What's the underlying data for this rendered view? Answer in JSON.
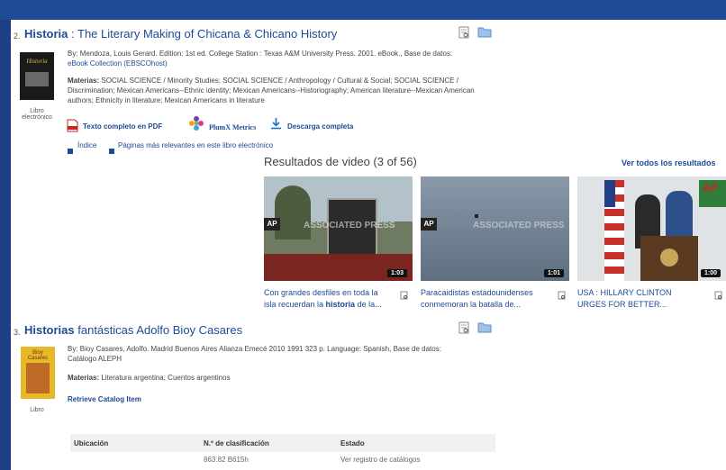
{
  "result2": {
    "number": "2.",
    "title_bold": "Historia",
    "title_rest": " : The Literary Making of Chicana & Chicano History",
    "cover_text": "Historia",
    "byline": "By: Mendoza, Louis Gerard. Edition: 1st ed. College Station : Texas A&M University Press. 2001. eBook., Base de datos:",
    "db_link": "eBook Collection (EBSCOhost)",
    "subjects_label": "Materias:",
    "subjects": "SOCIAL SCIENCE / Minority Studies; SOCIAL SCIENCE / Anthropology / Cultural & Social; SOCIAL SCIENCE / Discrimination; Mexican Americans--Ethnic identity; Mexican Americans--Historiography; American literature--Mexican American authors; Ethnicity in literature; Mexican Americans in literature",
    "format_line1": "Libro",
    "format_line2": "electrónico",
    "pdf_link": "Texto completo en PDF",
    "plumx": "PlumX Metrics",
    "download": "Descarga completa",
    "index_link": "Índice",
    "pages_link": "Páginas más relevantes en este libro electrónico"
  },
  "videos": {
    "heading": "Resultados de video (3 of 56)",
    "see_all": "Ver todos los resultados",
    "items": [
      {
        "duration": "1:03",
        "caption1": "Con grandes desfiles en toda la",
        "caption2_pre": "isla recuerdan la ",
        "caption2_bold": "historia",
        "caption2_post": " de la...",
        "watermark": "ASSOCIATED PRESS",
        "ap": "AP"
      },
      {
        "duration": "1:01",
        "caption1": "Paracaidistas estadounidenses",
        "caption2_pre": "conmemoran la batalla de...",
        "caption2_bold": "",
        "caption2_post": "",
        "watermark": "ASSOCIATED PRESS",
        "ap": "AP"
      },
      {
        "duration": "1:00",
        "caption1": "USA : HILLARY CLINTON",
        "caption2_pre": "URGES FOR BETTER...",
        "caption2_bold": "",
        "caption2_post": "",
        "watermark": "",
        "ap": "AP"
      }
    ]
  },
  "result3": {
    "number": "3.",
    "title_bold": "Historias",
    "title_rest": " fantásticas Adolfo Bioy Casares",
    "byline": "By: Bioy Casares, Adolfo. Madrid Buenos Aires Alianza Emecé 2010 1991 323 p. Language: Spanish, Base de datos:",
    "db_text": "Catálogo ALEPH",
    "subjects_label": "Materias:",
    "subjects": "Literatura argentina; Cuentos argentinos",
    "retrieve": "Retrieve Catalog Item",
    "format": "Libro",
    "cover_text": "Bioy Casares",
    "table": {
      "col1": "Ubicación",
      "col2": "N.º de clasificación",
      "col3": "Estado",
      "row_callno": "863.82 B615h",
      "row_status": "Ver registro de catálogos"
    }
  },
  "colors": {
    "link": "#1d4a94",
    "background": "#1c3f86",
    "panel": "#ffffff"
  }
}
